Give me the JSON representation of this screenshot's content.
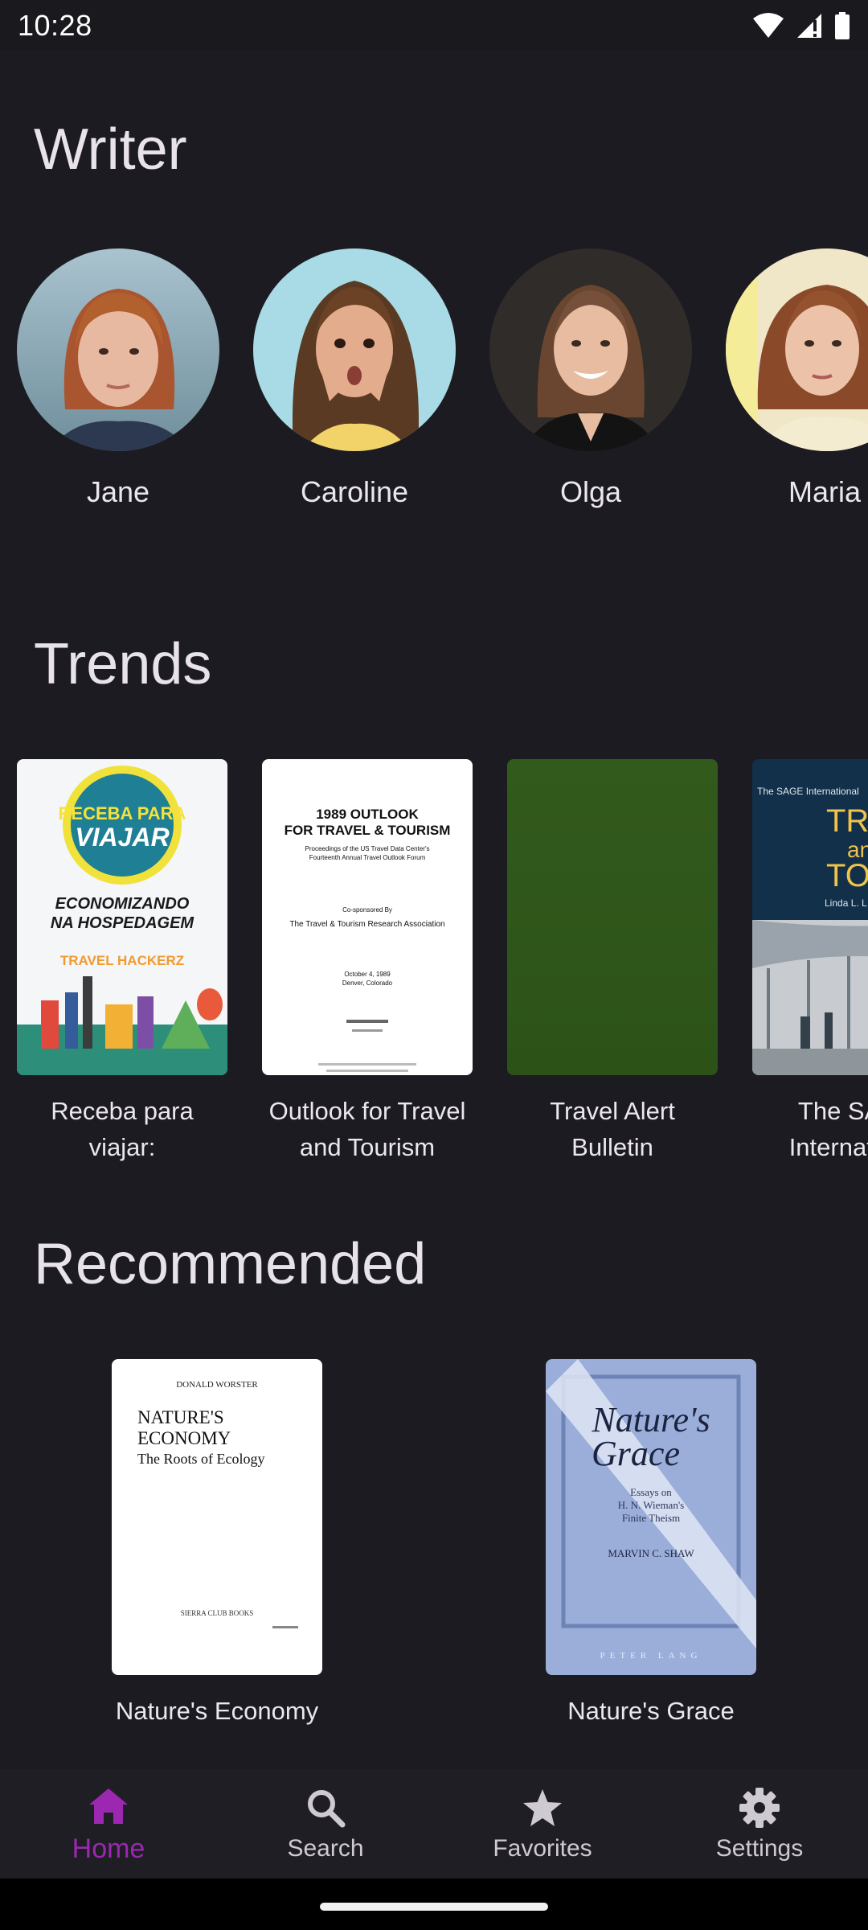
{
  "status_bar": {
    "time": "10:28"
  },
  "sections": {
    "writer": "Writer",
    "trends": "Trends",
    "recommended": "Recommended"
  },
  "writers": [
    {
      "name": "Jane"
    },
    {
      "name": "Caroline"
    },
    {
      "name": "Olga"
    },
    {
      "name": "Maria"
    }
  ],
  "trends": [
    {
      "title": "Receba para viajar:",
      "cover_text": {
        "badge_line1": "RECEBA PARA",
        "badge_line2": "VIAJAR",
        "sub_line1": "ECONOMIZANDO",
        "sub_line2": "NA HOSPEDAGEM",
        "brand": "TRAVEL HACKERZ"
      }
    },
    {
      "title": "Outlook for Travel and Tourism",
      "cover_text": {
        "line1": "1989 OUTLOOK",
        "line2": "FOR TRAVEL & TOURISM",
        "line3": "Proceedings of the US Travel Data Center's",
        "line4": "Fourteenth Annual Travel Outlook Forum",
        "line5": "Co-sponsored By",
        "line6": "The Travel & Tourism Research Association",
        "line7": "October 4, 1989",
        "line8": "Denver, Colorado"
      }
    },
    {
      "title": "Travel Alert Bulletin"
    },
    {
      "title": "The SAGE International",
      "cover_text": {
        "line1": "The SAGE International",
        "line2": "TRAV",
        "line3": "and",
        "line4": "TOUR",
        "line5": "Linda L. L"
      }
    }
  ],
  "recommended": [
    {
      "title": "Nature's Economy",
      "cover_text": {
        "author": "DONALD WORSTER",
        "line1": "NATURE'S",
        "line2": "ECONOMY",
        "line3": "The Roots of Ecology",
        "publisher": "SIERRA CLUB BOOKS"
      }
    },
    {
      "title": "Nature's Grace",
      "cover_text": {
        "line1": "Nature's",
        "line2": "Grace",
        "line3": "Essays on",
        "line4": "H. N. Wieman's",
        "line5": "Finite Theism",
        "author": "MARVIN C. SHAW",
        "publisher": "PETER LANG"
      }
    }
  ],
  "nav": [
    {
      "label": "Home",
      "icon": "home-icon",
      "active": true
    },
    {
      "label": "Search",
      "icon": "search-icon",
      "active": false
    },
    {
      "label": "Favorites",
      "icon": "star-icon",
      "active": false
    },
    {
      "label": "Settings",
      "icon": "gear-icon",
      "active": false
    }
  ],
  "colors": {
    "background": "#1c1b21",
    "accent": "#9c27b0",
    "nav_background": "#1f1e24"
  }
}
